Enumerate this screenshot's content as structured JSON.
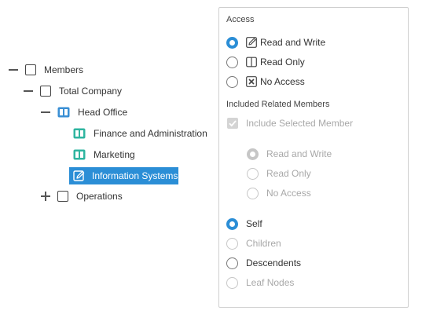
{
  "tree": {
    "members": {
      "label": "Members",
      "toggle": "collapse"
    },
    "total_company": {
      "label": "Total Company",
      "toggle": "collapse"
    },
    "head_office": {
      "label": "Head Office",
      "toggle": "collapse"
    },
    "finance": {
      "label": "Finance and Administration"
    },
    "marketing": {
      "label": "Marketing"
    },
    "information_systems": {
      "label": "Information Systems",
      "selected": true
    },
    "operations": {
      "label": "Operations",
      "toggle": "expand"
    }
  },
  "access": {
    "title": "Access",
    "options": [
      {
        "label": "Read and Write",
        "icon": "edit-icon",
        "checked": true
      },
      {
        "label": "Read Only",
        "icon": "book-icon",
        "checked": false
      },
      {
        "label": "No Access",
        "icon": "no-access-icon",
        "checked": false
      }
    ]
  },
  "related": {
    "title": "Included Related Members",
    "include_selected_label": "Include Selected Member",
    "include_selected_checked": true,
    "sub_options": [
      {
        "label": "Read and Write",
        "checked": true,
        "disabled": true
      },
      {
        "label": "Read Only",
        "checked": false,
        "disabled": true
      },
      {
        "label": "No Access",
        "checked": false,
        "disabled": true
      }
    ],
    "scope_options": [
      {
        "label": "Self",
        "checked": true,
        "disabled": false
      },
      {
        "label": "Children",
        "checked": false,
        "disabled": true
      },
      {
        "label": "Descendents",
        "checked": false,
        "disabled": false
      },
      {
        "label": "Leaf Nodes",
        "checked": false,
        "disabled": true
      }
    ]
  },
  "colors": {
    "accent": "#2b8ed6",
    "teal": "#2fb5a0",
    "disabled": "#a8a8a8"
  }
}
